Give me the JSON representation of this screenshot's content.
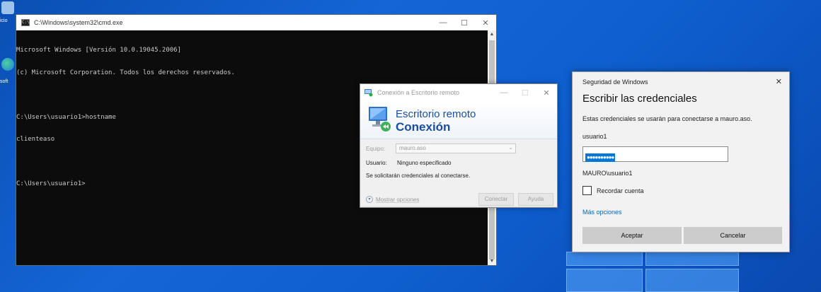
{
  "desktop": {
    "icon_label_1": "icio",
    "icon_label_2": "soft"
  },
  "cmd": {
    "title": "C:\\Windows\\system32\\cmd.exe",
    "lines": [
      "Microsoft Windows [Versión 10.0.19045.2006]",
      "(c) Microsoft Corporation. Todos los derechos reservados.",
      "",
      "C:\\Users\\usuario1>hostname",
      "clienteaso",
      "",
      "C:\\Users\\usuario1>"
    ],
    "minimize": "—",
    "maximize": "☐",
    "close": "✕"
  },
  "rdp": {
    "title": "Conexión a Escritorio remoto",
    "banner_line1": "Escritorio remoto",
    "banner_line2": "Conexión",
    "computer_label": "Equipo:",
    "computer_value": "mauro.aso",
    "user_label": "Usuario:",
    "user_value": "Ninguno especificado",
    "note": "Se solicitarán credenciales al conectarse.",
    "show_options": "Mostrar opciones",
    "connect_button": "Conectar",
    "help_button": "Ayuda",
    "minimize": "—",
    "maximize": "☐",
    "close": "✕"
  },
  "security": {
    "header": "Seguridad de Windows",
    "close": "✕",
    "title": "Escribir las credenciales",
    "description": "Estas credenciales se usarán para conectarse a mauro.aso.",
    "username": "usuario1",
    "password_mask": "●●●●●●●●●●",
    "domain_user": "MAURO\\usuario1",
    "remember_label": "Recordar cuenta",
    "remember_checked": false,
    "more_options": "Más opciones",
    "ok_button": "Aceptar",
    "cancel_button": "Cancelar"
  },
  "colors": {
    "accent": "#0078d7",
    "link": "#0067c0",
    "rdp_brand": "#1b4d9c"
  }
}
